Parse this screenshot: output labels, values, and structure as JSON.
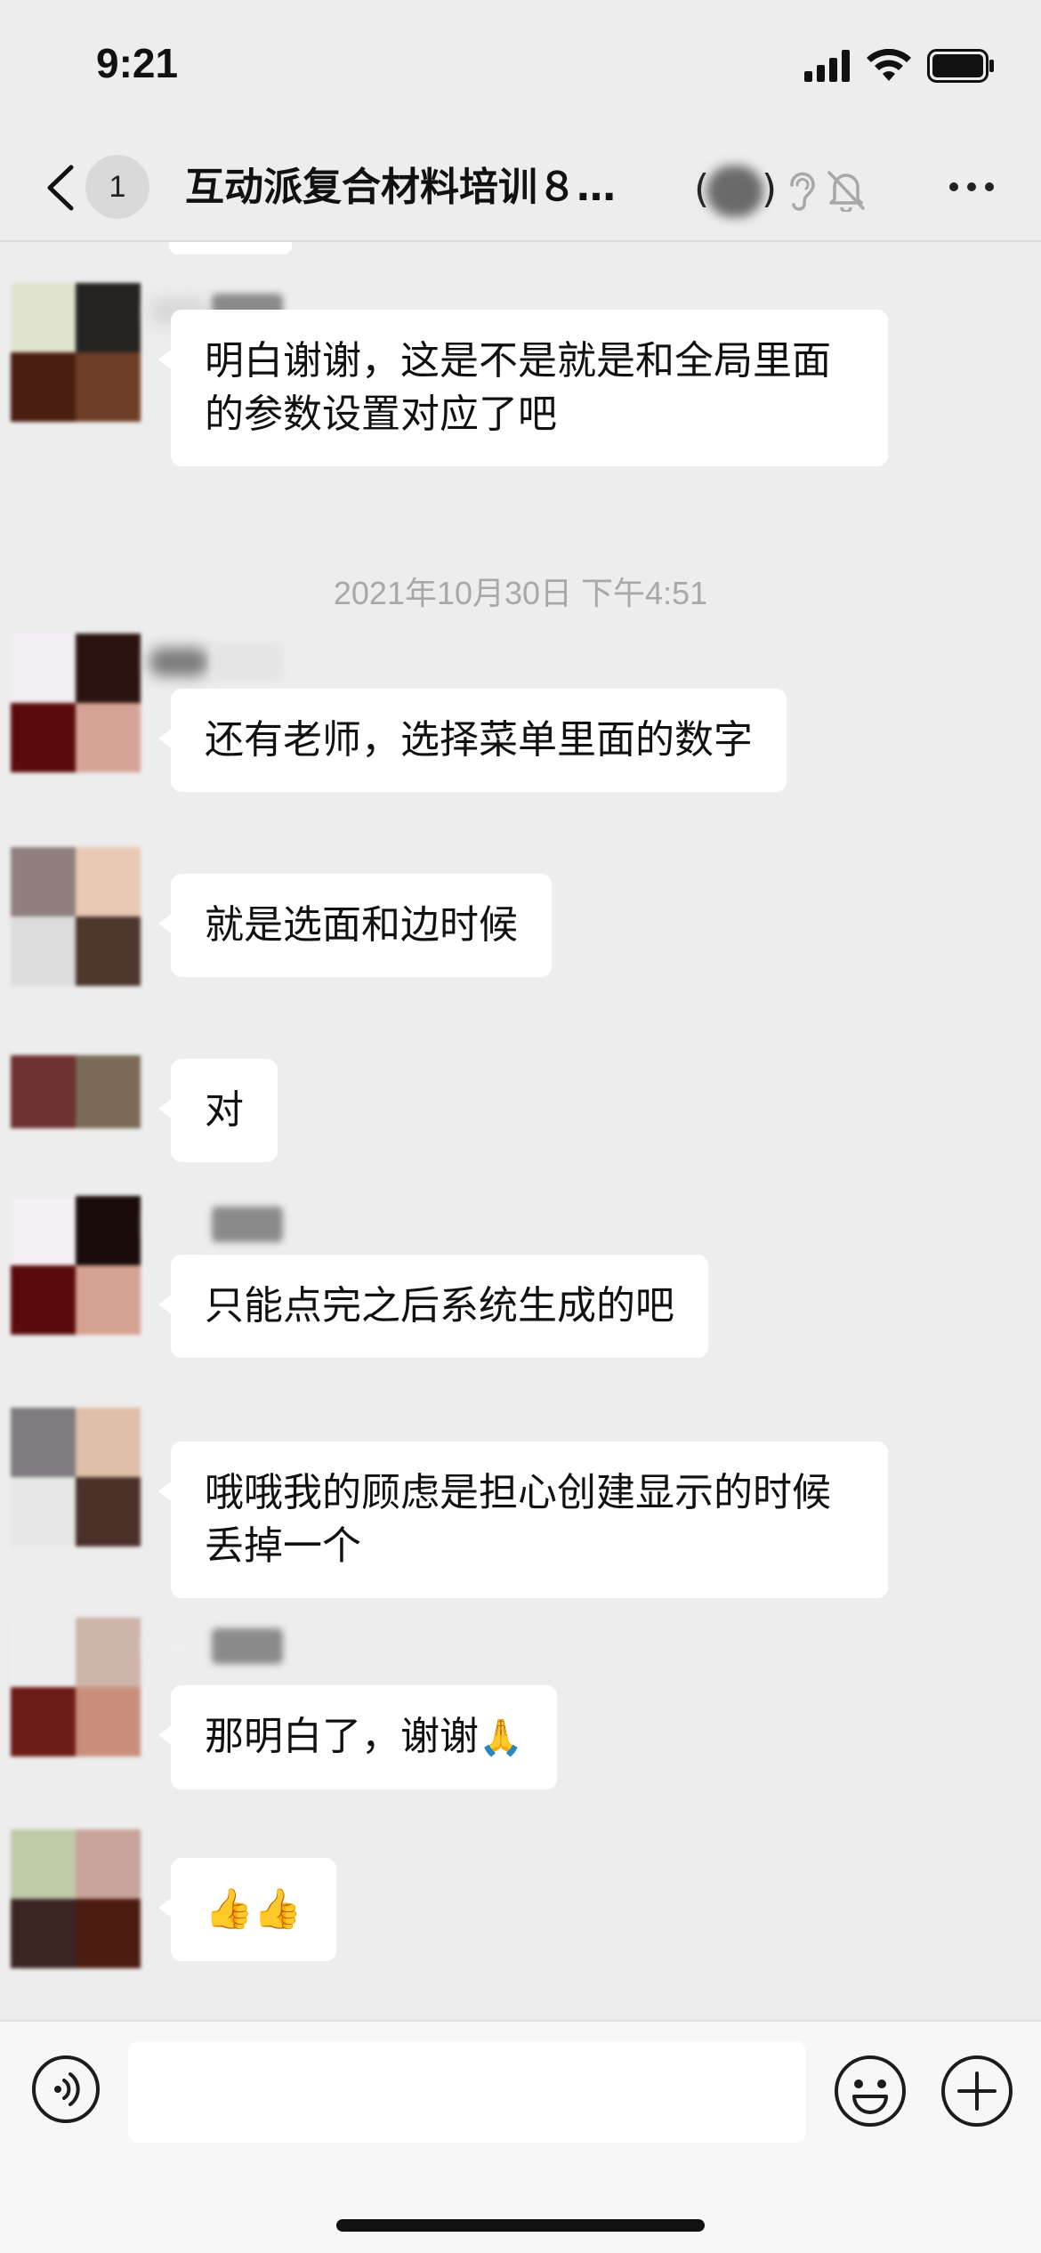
{
  "status_bar": {
    "time": "9:21"
  },
  "nav": {
    "unread_count": "1",
    "title": "互动派复合材料培训８…",
    "member_count_prefix": "(",
    "member_count_suffix": ")"
  },
  "messages": [
    {
      "text": "明白谢谢，这是不是就是和全局里面的参数设置对应了吧",
      "avatar_colors": [
        "#e0e3cf",
        "#252321",
        "#4b1e12",
        "#6e3e26"
      ]
    },
    {
      "text": "还有老师，选择菜单里面的数字",
      "avatar_colors": [
        "#f1eff3",
        "#2b1410",
        "#5a0a0c",
        "#d6a496"
      ]
    },
    {
      "text": "就是选面和边时候",
      "avatar_colors": [
        "#8f7f7e",
        "#e8c9b5",
        "#dcdcdc",
        "#4d362c"
      ]
    },
    {
      "text": "对",
      "avatar_colors": [
        "#6e3231",
        "#7a6a55",
        "#ededed",
        "#ededed"
      ]
    },
    {
      "text": "只能点完之后系统生成的吧",
      "avatar_colors": [
        "#f3eff4",
        "#1a0c08",
        "#5a0a0c",
        "#d5a191"
      ]
    },
    {
      "text": "哦哦我的顾虑是担心创建显示的时候丢掉一个",
      "avatar_colors": [
        "#7d7b7e",
        "#dfbfa8",
        "#e6e6e6",
        "#4a3029"
      ]
    },
    {
      "text": "那明白了，谢谢",
      "emoji": "🙏",
      "avatar_colors": [
        "#ededed",
        "#cdb4a8",
        "#6c1b16",
        "#c98f7c"
      ]
    },
    {
      "text": "👍👍",
      "avatar_colors": [
        "#bfcaa7",
        "#c7a39a",
        "#3b2523",
        "#4b1c10"
      ]
    }
  ],
  "time_separator": "2021年10月30日 下午4:51",
  "input": {
    "placeholder": ""
  }
}
